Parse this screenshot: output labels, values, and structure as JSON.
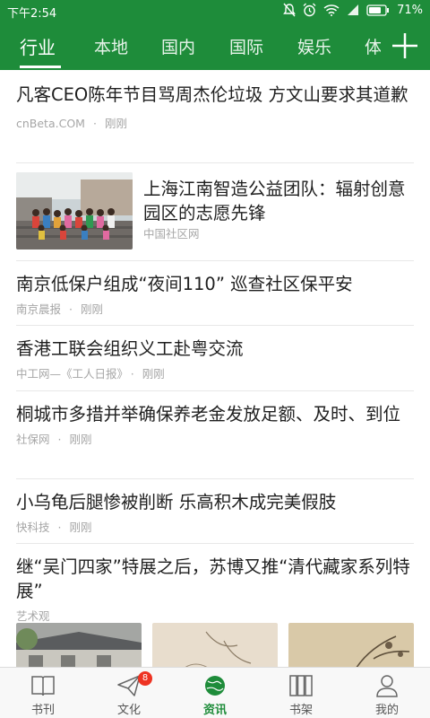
{
  "status_bar": {
    "time": "下午2:54",
    "battery": "71%"
  },
  "channels": {
    "tabs": [
      "行业",
      "本地",
      "国内",
      "国际",
      "娱乐",
      "体"
    ],
    "active": "行业"
  },
  "feed": [
    {
      "title": "凡客CEO陈年节目骂周杰伦垃圾 方文山要求其道歉",
      "source": "cnBeta.COM",
      "time": "刚刚"
    },
    {
      "title": "上海江南智造公益团队：辐射创意园区的志愿先锋",
      "source": "中国社区网",
      "time": ""
    },
    {
      "title": "南京低保户组成“夜间110” 巡查社区保平安",
      "source": "南京晨报",
      "time": "刚刚"
    },
    {
      "title": "香港工联会组织义工赴粤交流",
      "source": "中工网—《工人日报》",
      "time": "刚刚"
    },
    {
      "title": "桐城市多措并举确保养老金发放足额、及时、到位",
      "source": "社保网",
      "time": "刚刚"
    },
    {
      "title": "小乌龟后腿惨被削断 乐高积木成完美假肢",
      "source": "快科技",
      "time": "刚刚"
    },
    {
      "title": "继“吴门四家”特展之后，苏博又推“清代藏家系列特展”",
      "source": "艺术观",
      "time": ""
    }
  ],
  "bottom_nav": [
    {
      "label": "书刊",
      "icon": "book-icon"
    },
    {
      "label": "文化",
      "icon": "paper-plane-icon",
      "badge": "8"
    },
    {
      "label": "资讯",
      "icon": "globe-icon",
      "active": true
    },
    {
      "label": "书架",
      "icon": "bookshelf-icon"
    },
    {
      "label": "我的",
      "icon": "user-icon"
    }
  ],
  "colors": {
    "brand_green": "#1e8c3a",
    "badge_red": "#ee3322",
    "meta_gray": "#a6a6a6"
  }
}
